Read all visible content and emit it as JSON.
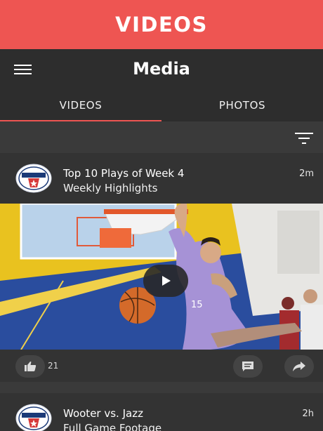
{
  "banner": {
    "title": "VIDEOS"
  },
  "appbar": {
    "title": "Media",
    "menu_icon": "hamburger-icon"
  },
  "tabs": [
    {
      "label": "VIDEOS",
      "active": true
    },
    {
      "label": "PHOTOS",
      "active": false
    }
  ],
  "filter": {
    "icon": "filter-icon"
  },
  "posts": [
    {
      "title": "Top 10 Plays of Week 4",
      "subtitle": "Weekly Highlights",
      "time": "2m",
      "likes": "21",
      "logo": "dream-league-logo",
      "media": "basketball-dunk-video-thumbnail"
    },
    {
      "title": "Wooter vs. Jazz",
      "subtitle": "Full Game Footage",
      "time": "2h",
      "logo": "dream-league-logo"
    }
  ],
  "colors": {
    "accent": "#ee5552",
    "bar": "#2d2d2d",
    "card": "#333333",
    "background": "#3a3a3a"
  }
}
